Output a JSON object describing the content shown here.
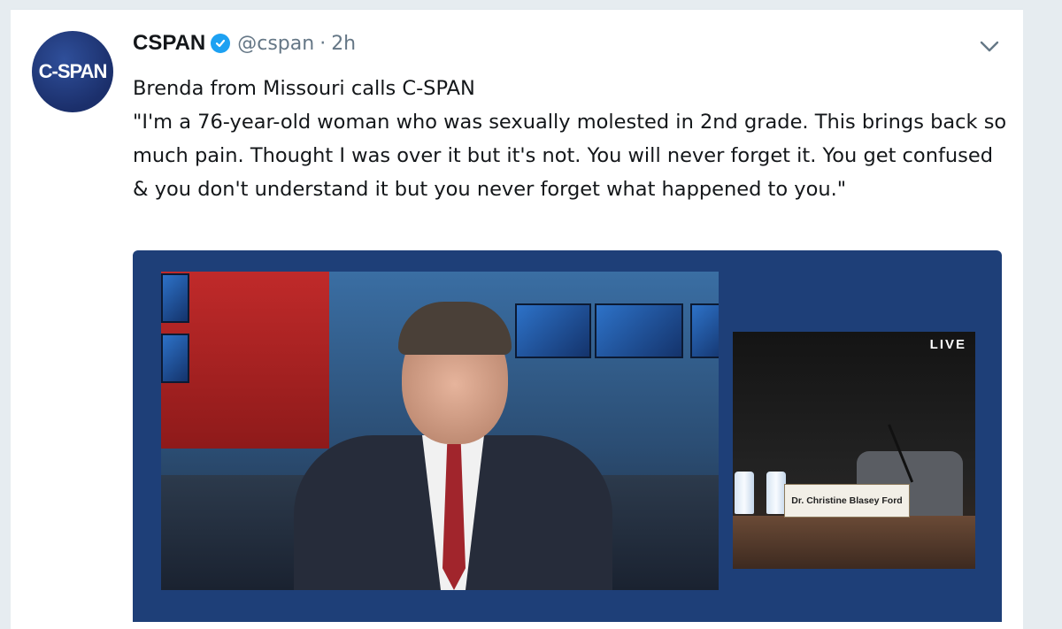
{
  "tweet": {
    "avatar_text": "C-SPAN",
    "display_name": "CSPAN",
    "handle": "@cspan",
    "separator": "·",
    "time": "2h",
    "text_lines": [
      "Brenda from Missouri calls C-SPAN",
      "\"I'm a 76-year-old woman who was sexually molested in 2nd grade. This brings back so much pain. Thought I was over it but it's not. You will never forget it. You get confused & you don't understand it but you never forget what happened to you.\""
    ]
  },
  "media": {
    "live_label": "LIVE",
    "nameplate": "Dr. Christine Blasey Ford"
  },
  "icons": {
    "verified": "verified-badge-icon",
    "menu": "chevron-down-icon"
  },
  "colors": {
    "name": "#14171a",
    "secondary": "#657786",
    "verified": "#1da1f2",
    "media_bg": "#1e3f78"
  }
}
